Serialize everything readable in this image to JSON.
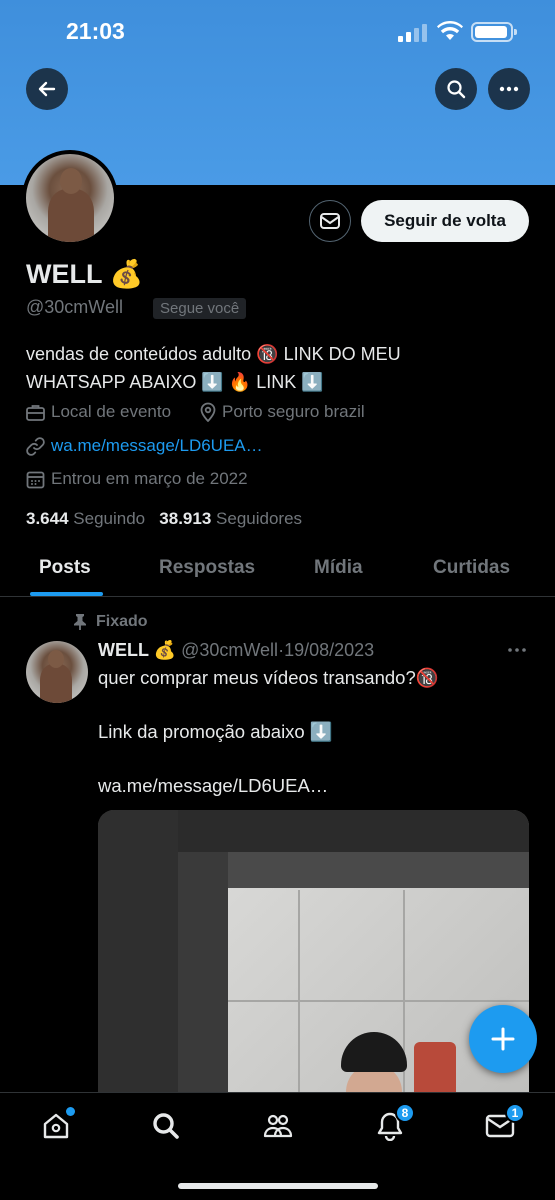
{
  "status_bar": {
    "time": "21:03"
  },
  "profile": {
    "name": "WELL 💰",
    "handle": "@30cmWell",
    "follows_you": "Segue você",
    "bio_line1": "vendas de conteúdos adulto 🔞 LINK DO MEU",
    "bio_line2": "WHATSAPP ABAIXO ⬇️ 🔥 LINK ⬇️",
    "category": "Local de evento",
    "location": "Porto seguro brazil",
    "website": "wa.me/message/LD6UEA…",
    "joined": "Entrou em março de 2022",
    "following_count": "3.644",
    "following_label": "Seguindo",
    "followers_count": "38.913",
    "followers_label": "Seguidores",
    "follow_button": "Seguir de volta"
  },
  "tabs": [
    {
      "label": "Posts",
      "active": true
    },
    {
      "label": "Respostas",
      "active": false
    },
    {
      "label": "Mídia",
      "active": false
    },
    {
      "label": "Curtidas",
      "active": false
    }
  ],
  "pinned_post": {
    "pinned_label": "Fixado",
    "author_name": "WELL 💰",
    "author_handle": "@30cmWell",
    "separator": "·",
    "date": "19/08/2023",
    "line1": "quer comprar meus vídeos transando?🔞",
    "line2": "Link da promoção abaixo ⬇️",
    "link": "wa.me/message/LD6UEA…"
  },
  "bottom_nav": {
    "items": [
      "home-icon",
      "search-icon",
      "communities-icon",
      "notifications-icon",
      "messages-icon"
    ],
    "notifications_badge": "8",
    "messages_badge": "1"
  },
  "colors": {
    "accent": "#1d9bf0",
    "banner": "#4a9be6",
    "background": "#000000"
  }
}
